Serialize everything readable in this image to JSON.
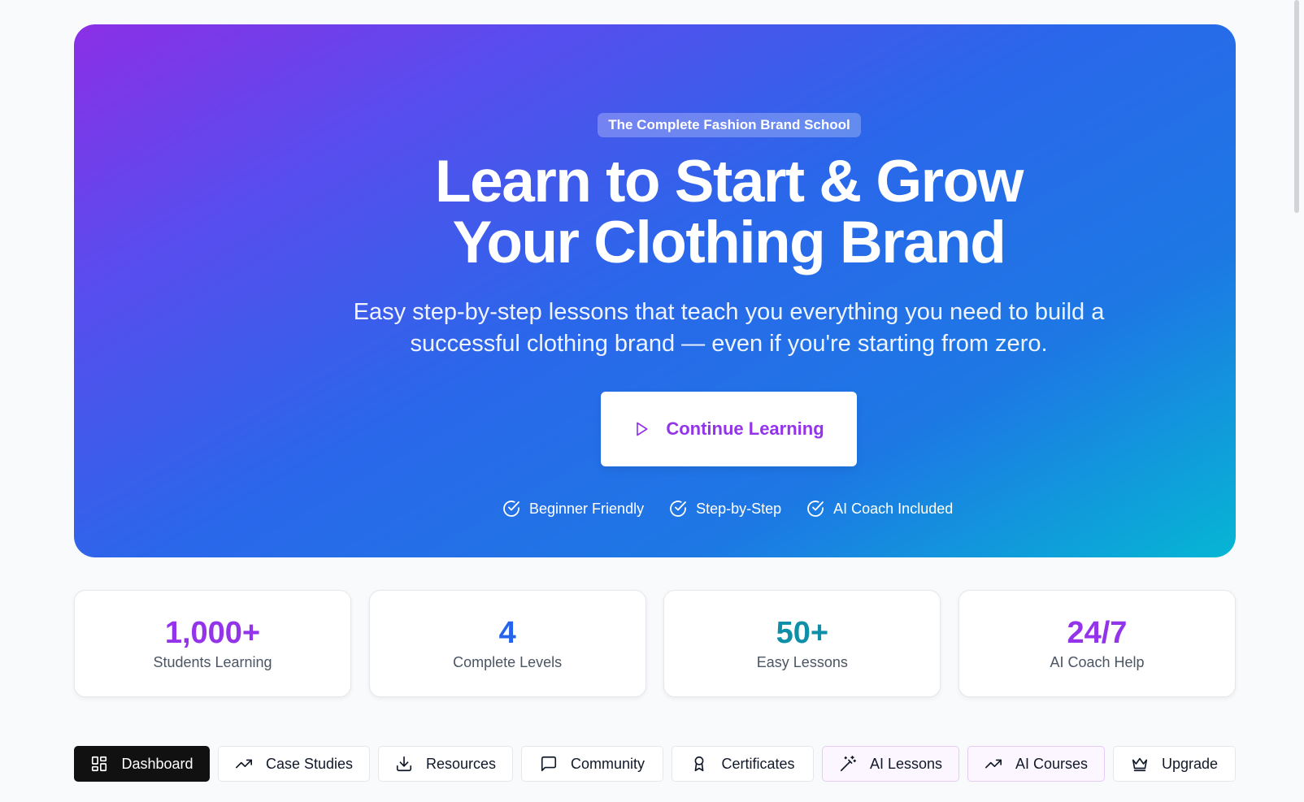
{
  "hero": {
    "badge": "The Complete Fashion Brand School",
    "headline_line1": "Learn to Start & Grow",
    "headline_line2": "Your Clothing Brand",
    "subtitle_line1": "Easy step-by-step lessons that teach you everything you need to build a",
    "subtitle_line2": "successful clothing brand — even if you're starting from zero.",
    "cta_label": "Continue Learning",
    "features": [
      "Beginner Friendly",
      "Step-by-Step",
      "AI Coach Included"
    ],
    "gradient_colors": [
      "#8b2fe6",
      "#2563eb",
      "#06b6d4"
    ]
  },
  "stats": [
    {
      "value": "1,000+",
      "label": "Students Learning",
      "color": "#9333ea"
    },
    {
      "value": "4",
      "label": "Complete Levels",
      "color": "#2563eb"
    },
    {
      "value": "50+",
      "label": "Easy Lessons",
      "color": "#0e8fa8"
    },
    {
      "value": "24/7",
      "label": "AI Coach Help",
      "color": "#9333ea"
    }
  ],
  "tabs": [
    {
      "label": "Dashboard",
      "icon": "dashboard-icon",
      "active": true
    },
    {
      "label": "Case Studies",
      "icon": "trending-up-icon"
    },
    {
      "label": "Resources",
      "icon": "download-icon"
    },
    {
      "label": "Community",
      "icon": "message-square-icon"
    },
    {
      "label": "Certificates",
      "icon": "award-icon"
    },
    {
      "label": "AI Lessons",
      "icon": "magic-wand-icon"
    },
    {
      "label": "AI Courses",
      "icon": "trending-up-icon"
    },
    {
      "label": "Upgrade",
      "icon": "crown-icon"
    }
  ]
}
